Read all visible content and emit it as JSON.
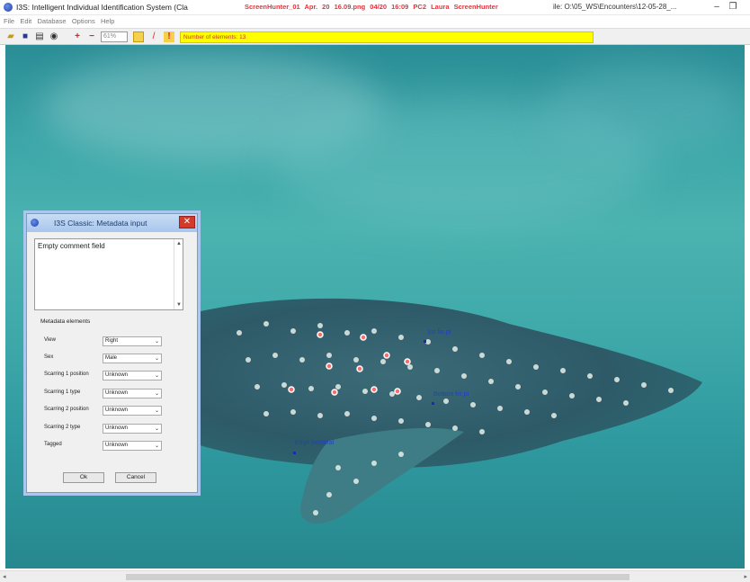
{
  "window": {
    "title": "I3S: Intelligent Individual Identification System (Cla",
    "overlay": "ScreenHunter_01 Apr. 20 16.09.png  04/20  16:09  PC2  Laura  ScreenHunter",
    "path": "ile: O:\\05_WS\\Encounters\\12-05-28_...",
    "minimize": "–",
    "restore": "❐"
  },
  "menu": [
    "File",
    "Edit",
    "Database",
    "Options",
    "Help"
  ],
  "toolbar": {
    "zoom": "61%",
    "status": "Number of elements: 13"
  },
  "markers": [
    {
      "label": "1st fin pt"
    },
    {
      "label": "Bottom fin pt"
    },
    {
      "label": "Edge pectoral"
    }
  ],
  "dialog": {
    "title": "I3S Classic: Metadata input",
    "close": "✕",
    "comment": "Empty comment field",
    "meta_header": "Metadata elements",
    "rows": [
      {
        "label": "View",
        "value": "Right"
      },
      {
        "label": "Sex",
        "value": "Male"
      },
      {
        "label": "Scarring 1 position",
        "value": "Unknown"
      },
      {
        "label": "Scarring 1 type",
        "value": "Unknown"
      },
      {
        "label": "Scarring 2 position",
        "value": "Unknown"
      },
      {
        "label": "Scarring 2 type",
        "value": "Unknown"
      },
      {
        "label": "Tagged",
        "value": "Unknown"
      }
    ],
    "ok": "Ok",
    "cancel": "Cancel"
  },
  "colors": {
    "water": "#3ca6a8",
    "status_bg": "#ffff00",
    "overlay_text": "#e8323c",
    "marker": "#2040c8"
  }
}
